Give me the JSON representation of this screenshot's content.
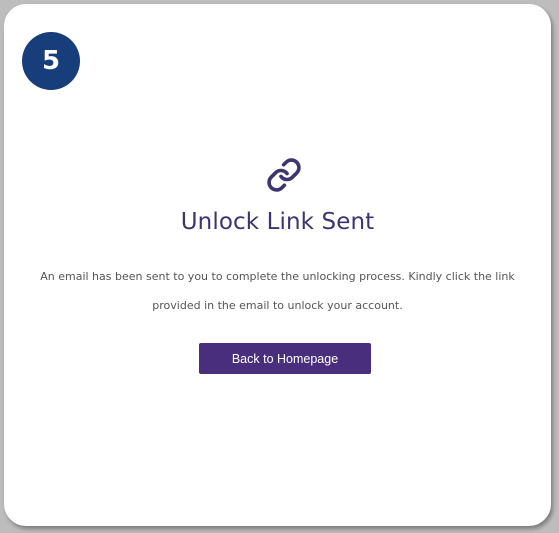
{
  "step": {
    "number": "5"
  },
  "icon": {
    "name": "link-icon",
    "color": "#3d3470"
  },
  "dialog": {
    "title": "Unlock Link Sent",
    "message": "An email has been sent to you to complete the unlocking process. Kindly click the link provided in the email to unlock your account.",
    "button_label": "Back to Homepage"
  },
  "colors": {
    "badge": "#173d7a",
    "button": "#4a2e7e",
    "title": "#3d3470",
    "card": "#ffffff"
  }
}
